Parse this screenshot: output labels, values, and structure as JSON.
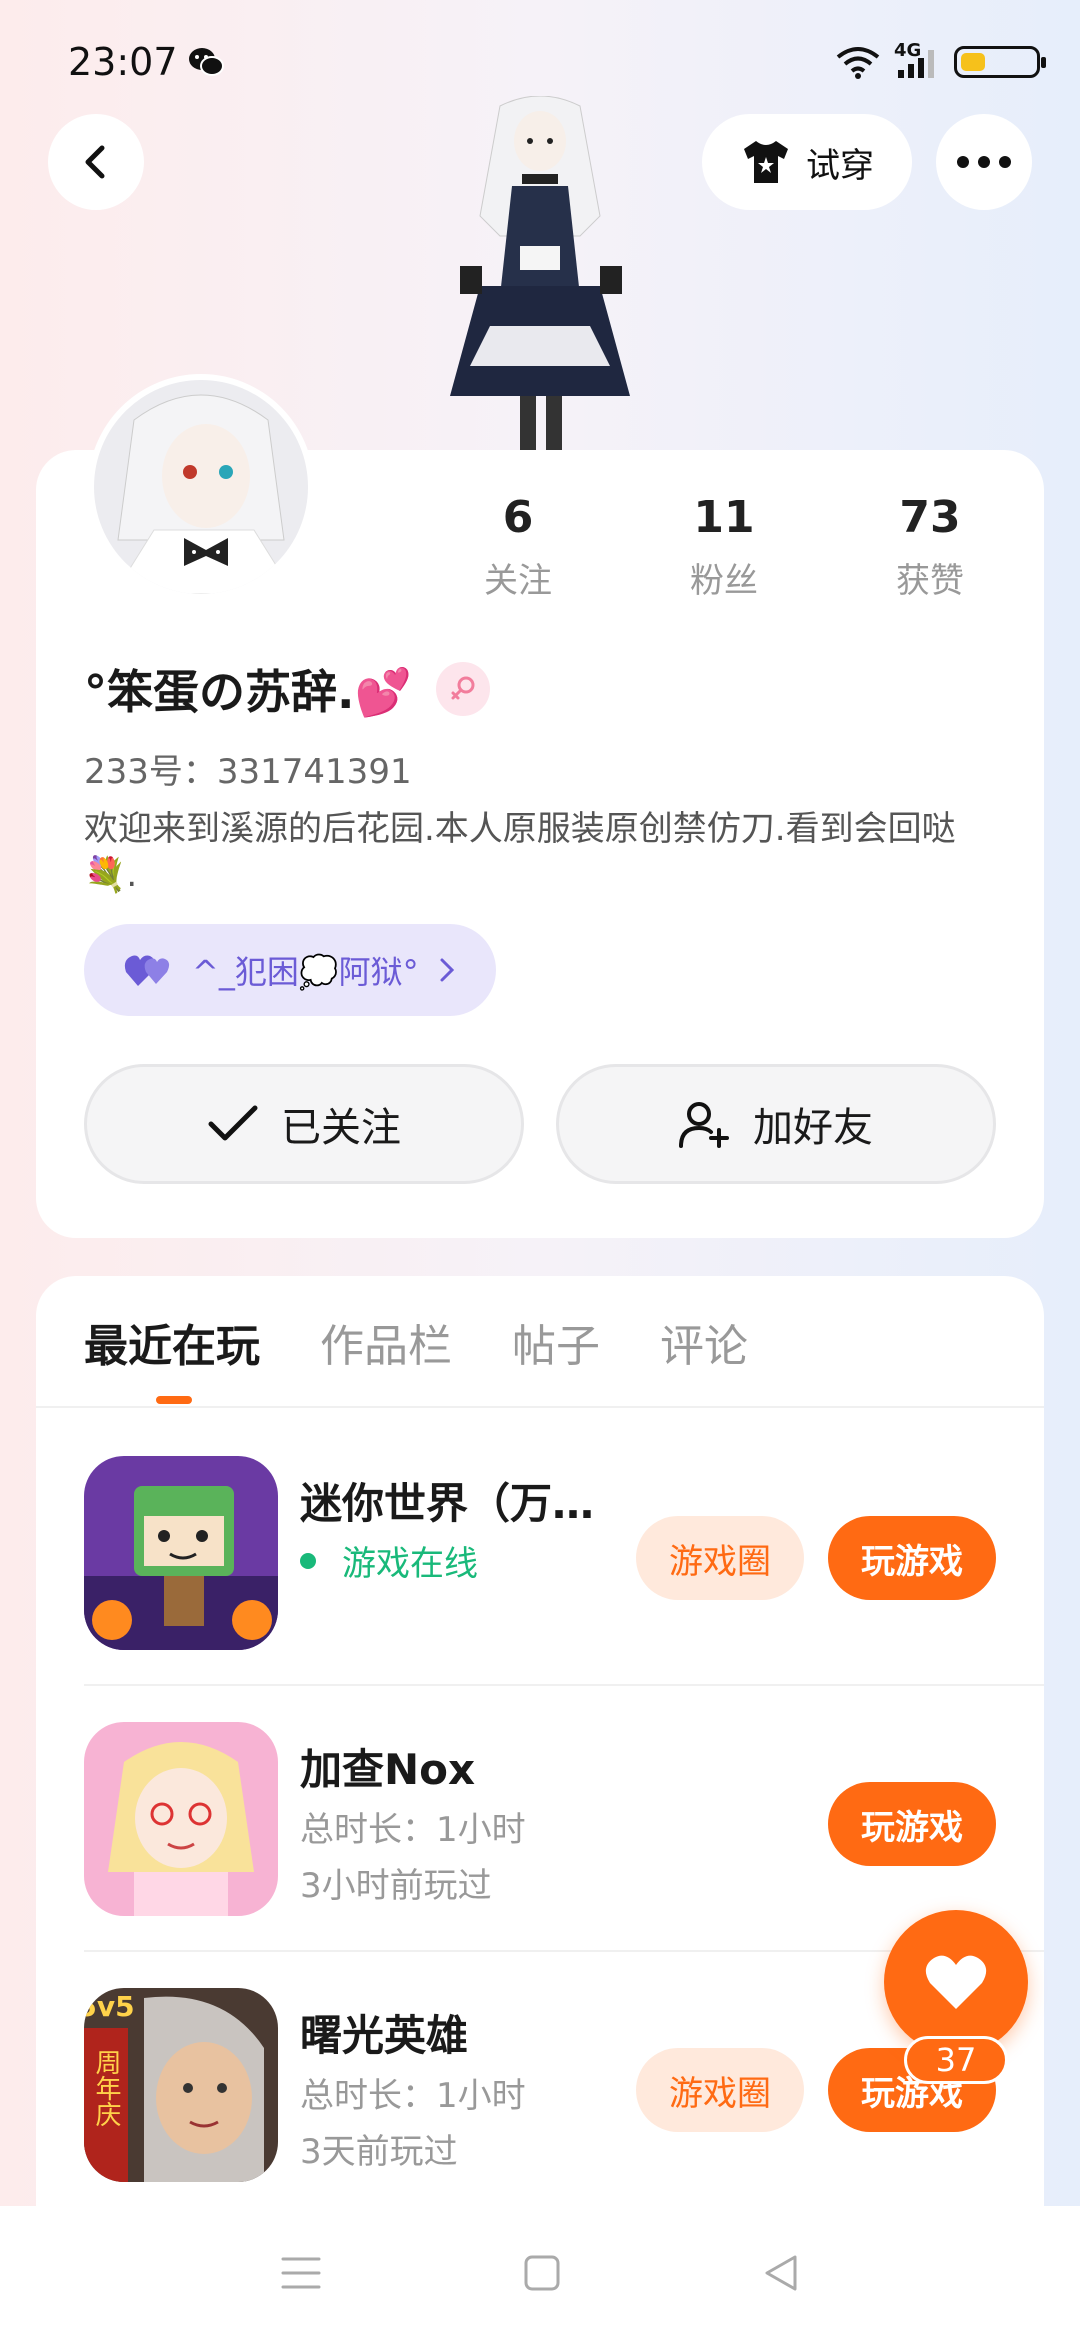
{
  "status_bar": {
    "time": "23:07",
    "network": "4G",
    "battery_level": 0.3
  },
  "header": {
    "tryon_label": "试穿"
  },
  "profile": {
    "stats": [
      {
        "value": "6",
        "label": "关注"
      },
      {
        "value": "11",
        "label": "粉丝"
      },
      {
        "value": "73",
        "label": "获赞"
      }
    ],
    "name": "°笨蛋の苏辞.💕",
    "gender": "female",
    "id_text": "233号：331741391",
    "bio": "欢迎来到溪源的后花园.本人原服装原创禁仿刀.看到会回哒💐.",
    "relation_chip": "^_犯困💭阿狱°",
    "follow_label": "已关注",
    "add_friend_label": "加好友"
  },
  "tabs": [
    "最近在玩",
    "作品栏",
    "帖子",
    "评论"
  ],
  "games": [
    {
      "title": "迷你世界（万…",
      "status": "游戏在线",
      "circle_label": "游戏圈",
      "play_label": "玩游戏"
    },
    {
      "title": "加查Nox",
      "duration": "总时长：1小时",
      "last_played": "3小时前玩过",
      "play_label": "玩游戏"
    },
    {
      "title": "曙光英雄",
      "duration": "总时长：1小时",
      "last_played": "3天前玩过",
      "circle_label": "游戏圈",
      "play_label": "玩游戏",
      "icon_text": "5v5",
      "icon_banner": "周年庆"
    }
  ],
  "like_fab": {
    "count": "37"
  },
  "colors": {
    "accent": "#ff6a13",
    "online": "#19b97a",
    "chip": "#6b5bd6"
  }
}
